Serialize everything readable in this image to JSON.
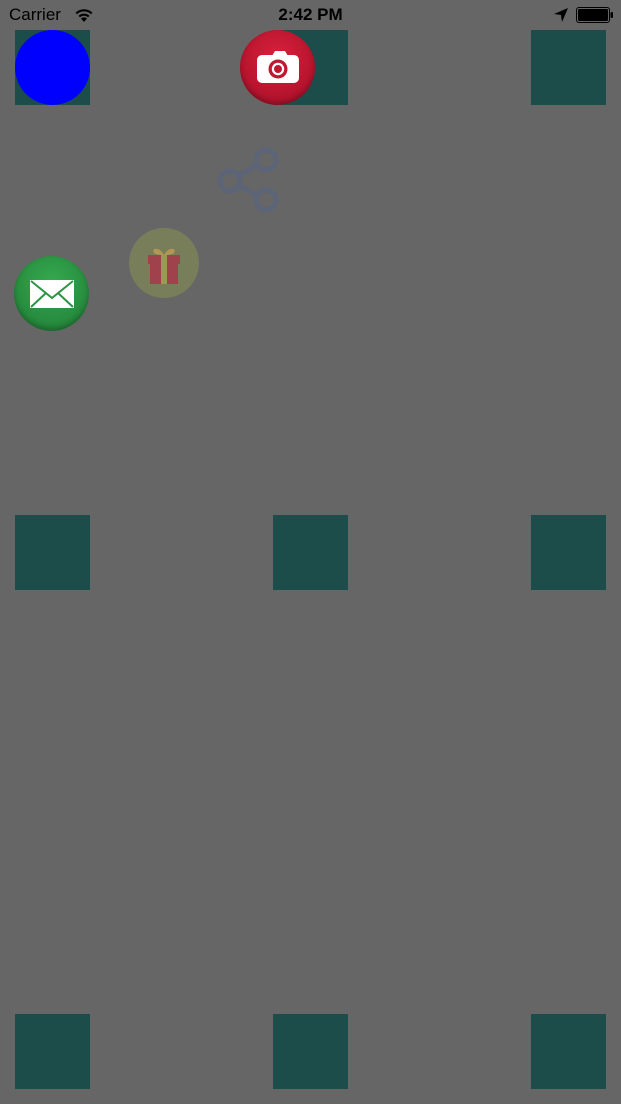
{
  "status_bar": {
    "carrier": "Carrier",
    "time": "2:42 PM",
    "wifi_icon": "wifi-icon",
    "location_icon": "location-arrow-icon",
    "battery_icon": "battery-icon"
  },
  "background_color": "#666666",
  "grid_squares": {
    "color": "#1c4d4b",
    "count": 9
  },
  "buttons": {
    "menu": {
      "icon": "blue-circle",
      "color": "#0000ff"
    },
    "camera": {
      "icon": "camera-icon",
      "color": "#c0182f"
    },
    "share": {
      "icon": "share-icon",
      "color": "#5c6478"
    },
    "gift": {
      "icon": "gift-icon",
      "color": "#7a7f5a"
    },
    "mail": {
      "icon": "envelope-icon",
      "color": "#2a9443"
    }
  }
}
